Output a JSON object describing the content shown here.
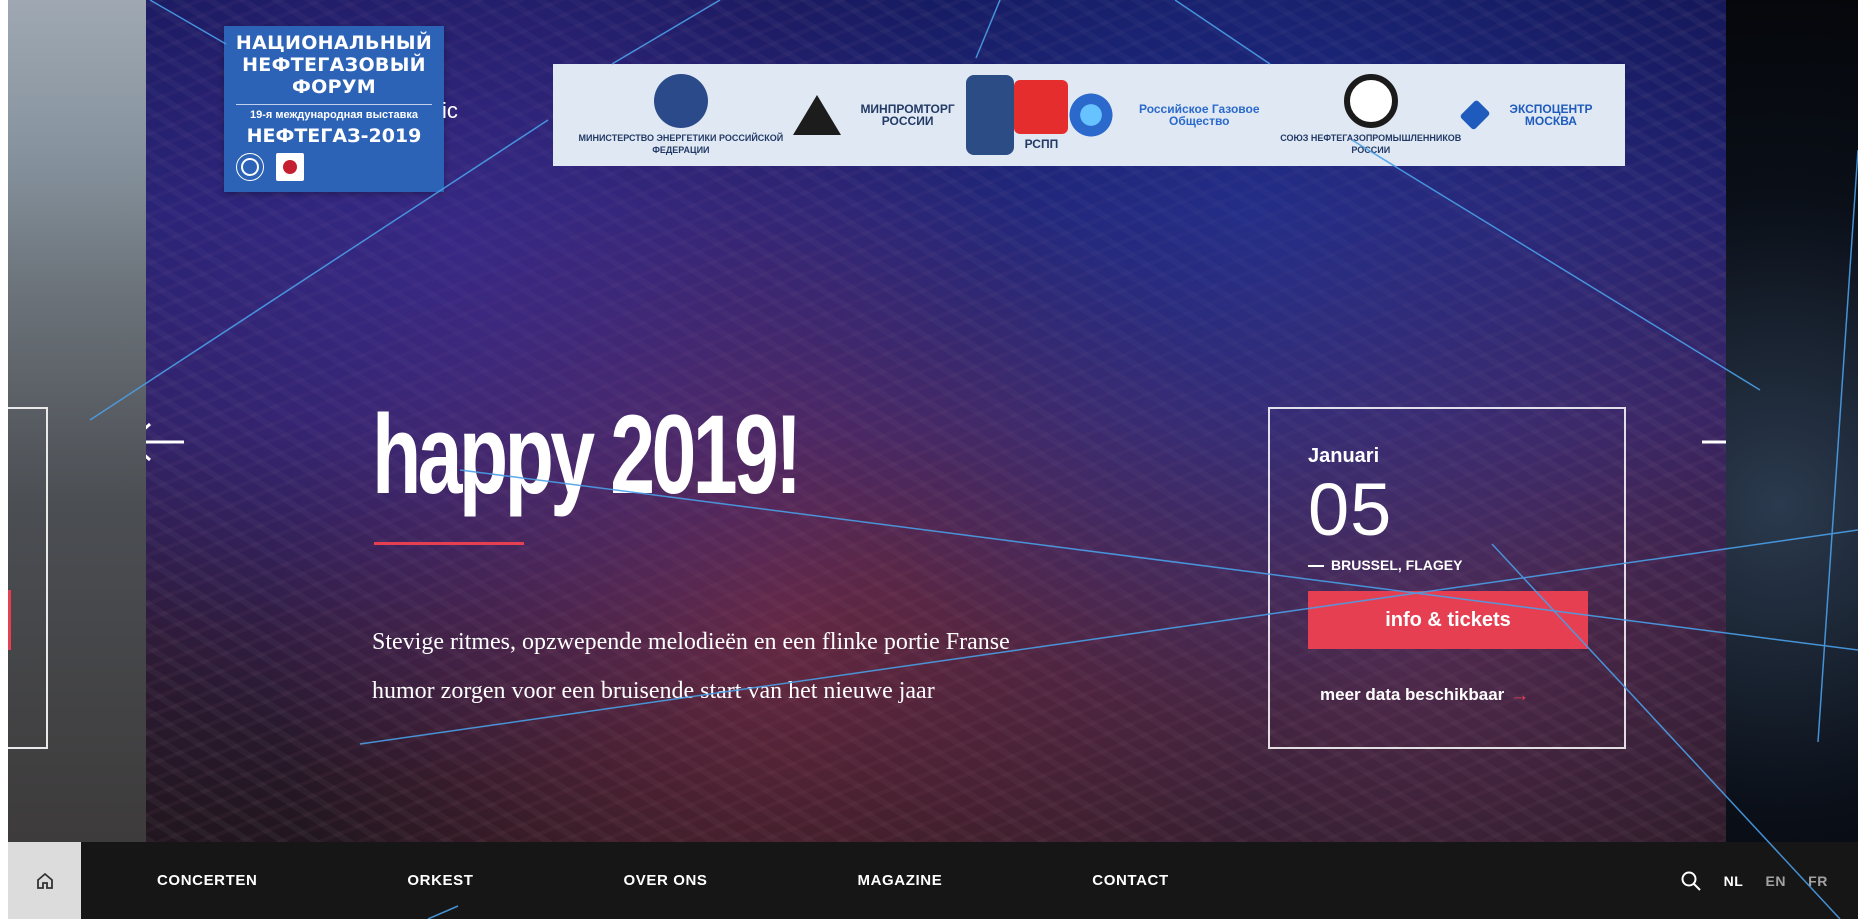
{
  "forum": {
    "line1": "НАЦИОНАЛЬНЫЙ",
    "line2": "НЕФТЕГАЗОВЫЙ",
    "line3": "ФОРУМ",
    "subtitle": "19-я международная выставка",
    "title": "НЕФТЕГАЗ-2019"
  },
  "partial_text": "ic",
  "sponsors": [
    {
      "name": "МИНИСТЕРСТВО ЭНЕРГЕТИКИ РОССИЙСКОЙ ФЕДЕРАЦИИ"
    },
    {
      "name": "МИНПРОМТОРГ РОССИИ"
    },
    {
      "name": ""
    },
    {
      "name": "РСПП"
    },
    {
      "name": "Российское Газовое Общество"
    },
    {
      "name": "СОЮЗ НЕФТЕГАЗОПРОМЫШЛЕННИКОВ РОССИИ"
    },
    {
      "name": "ЭКСПОЦЕНТР МОСКВА"
    }
  ],
  "hero": {
    "headline": "happy 2019!",
    "body": "Stevige ritmes, opzwepende melodieën en een flinke portie Franse humor zorgen voor een bruisende start van het nieuwe jaar"
  },
  "event": {
    "month": "Januari",
    "day": "05",
    "location": "BRUSSEL, FLAGEY",
    "tickets_label": "info & tickets",
    "more_label": "meer data beschikbaar"
  },
  "nav": {
    "links": [
      "CONCERTEN",
      "ORKEST",
      "OVER ONS",
      "MAGAZINE",
      "CONTACT"
    ],
    "langs": [
      "NL",
      "EN",
      "FR"
    ]
  },
  "icons": {
    "home": "home-icon",
    "search": "search-icon",
    "prev": "chevron-left-icon",
    "next": "chevron-right-icon",
    "scroll": "arrow-down-icon"
  },
  "colors": {
    "accent": "#e73f52",
    "nav_bg": "#161616",
    "banner_blue": "#2d63b7",
    "sponsor_bg": "#dfe8f3"
  }
}
